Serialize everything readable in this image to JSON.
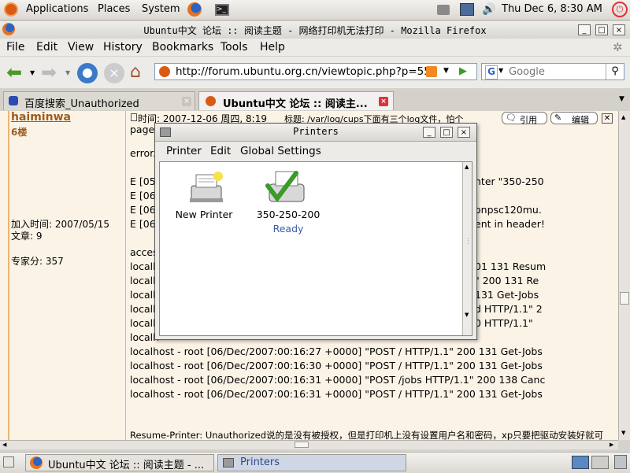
{
  "top_panel": {
    "menus": [
      "Applications",
      "Places",
      "System"
    ],
    "clock": "Thu Dec  6,  8:30 AM"
  },
  "firefox": {
    "title": "Ubuntu中文 论坛 :: 阅读主题 - 网络打印机无法打印 - Mozilla Firefox",
    "menu": [
      "File",
      "Edit",
      "View",
      "History",
      "Bookmarks",
      "Tools",
      "Help"
    ],
    "url": "http://forum.ubuntu.org.cn/viewtopic.php?p=550",
    "search_placeholder": "Google",
    "search_engine_letter": "G",
    "tabs": [
      {
        "label": "百度搜索_Unauthorized",
        "active": false
      },
      {
        "label": "Ubuntu中文 论坛 :: 阅读主...",
        "active": true
      }
    ]
  },
  "post": {
    "author": "haiminwa",
    "floor": "6楼",
    "joined": "加入时间: 2007/05/15",
    "posts": "文章: 9",
    "expert_score": "专家分: 357",
    "time_label": "时间: 2007-12-06 周四, 8:19",
    "subject": "标题: /var/log/cups下面有三个log文件，怕个",
    "subject_line2": "page",
    "quote_button": "引用",
    "edit_button": "编辑",
    "log_lines": [
      "error.",
      "E [05",
      "E [06",
      "E [06",
      "E [06",
      "acces",
      "localh",
      "localh",
      "localh",
      "localh",
      "localh",
      "localh",
      "localhost - root [06/Dec/2007:00:16:27 +0000] \"POST / HTTP/1.1\" 200 131 Get-Jobs",
      "localhost - root [06/Dec/2007:00:16:30 +0000] \"POST / HTTP/1.1\" 200 131 Get-Jobs",
      "localhost - root [06/Dec/2007:00:16:31 +0000] \"POST /jobs HTTP/1.1\" 200 138 Canc",
      "localhost - root [06/Dec/2007:00:16:31 +0000] \"POST / HTTP/1.1\" 200 131 Get-Jobs"
    ],
    "log_right_fragments": [
      "nter \"350-250",
      "onpsc120mu.",
      "ent in header!",
      "01 131 Resum",
      "\" 200 131 Re",
      "131 Get-Jobs",
      "d HTTP/1.1\" 2",
      "0 HTTP/1.1\""
    ],
    "footer_text": "Resume-Printer: Unauthorized说的是没有被授权，但是打印机上没有设置用户名和密码，xp只要把驱动安装好就可"
  },
  "printers_dialog": {
    "title": "Printers",
    "menu": [
      "Printer",
      "Edit",
      "Global Settings"
    ],
    "items": [
      {
        "name": "New Printer",
        "status": ""
      },
      {
        "name": "350-250-200",
        "status": "Ready"
      }
    ]
  },
  "taskbar": {
    "tasks": [
      "Ubuntu中文 论坛 :: 阅读主题 - ...",
      "Printers"
    ]
  },
  "colors": {
    "link_blue": "#2a4a8c",
    "author_orange": "#9b5d1f",
    "tab_close_red": "#d9343a",
    "ready_blue": "#3a5ba8"
  }
}
